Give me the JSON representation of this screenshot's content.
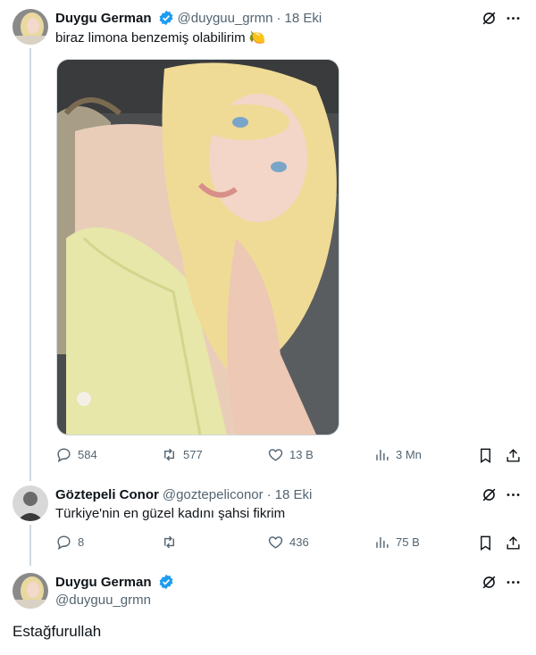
{
  "tweet1": {
    "author_name": "Duygu German",
    "handle": "@duyguu_grmn",
    "separator": "·",
    "date": "18 Eki",
    "text": "biraz limona benzemiş olabilirim",
    "emoji": "🍋",
    "replies": "584",
    "retweets": "577",
    "likes": "13 B",
    "views": "3 Mn"
  },
  "tweet2": {
    "author_name": "Göztepeli Conor",
    "handle": "@goztepeliconor",
    "separator": "·",
    "date": "18 Eki",
    "text": "Türkiye'nin en güzel kadını şahsi fikrim",
    "replies": "8",
    "retweets": "",
    "likes": "436",
    "views": "75 B"
  },
  "tweet3": {
    "author_name": "Duygu German",
    "handle": "@duyguu_grmn",
    "text": "Estağfurullah"
  },
  "colors": {
    "verified_blue": "#1d9bf0",
    "muted_text": "#536471",
    "thread_line": "#cfd9de"
  },
  "icons": [
    "grok-icon",
    "more-icon",
    "reply-icon",
    "retweet-icon",
    "like-icon",
    "views-icon",
    "bookmark-icon",
    "share-icon",
    "verified-badge-icon"
  ]
}
